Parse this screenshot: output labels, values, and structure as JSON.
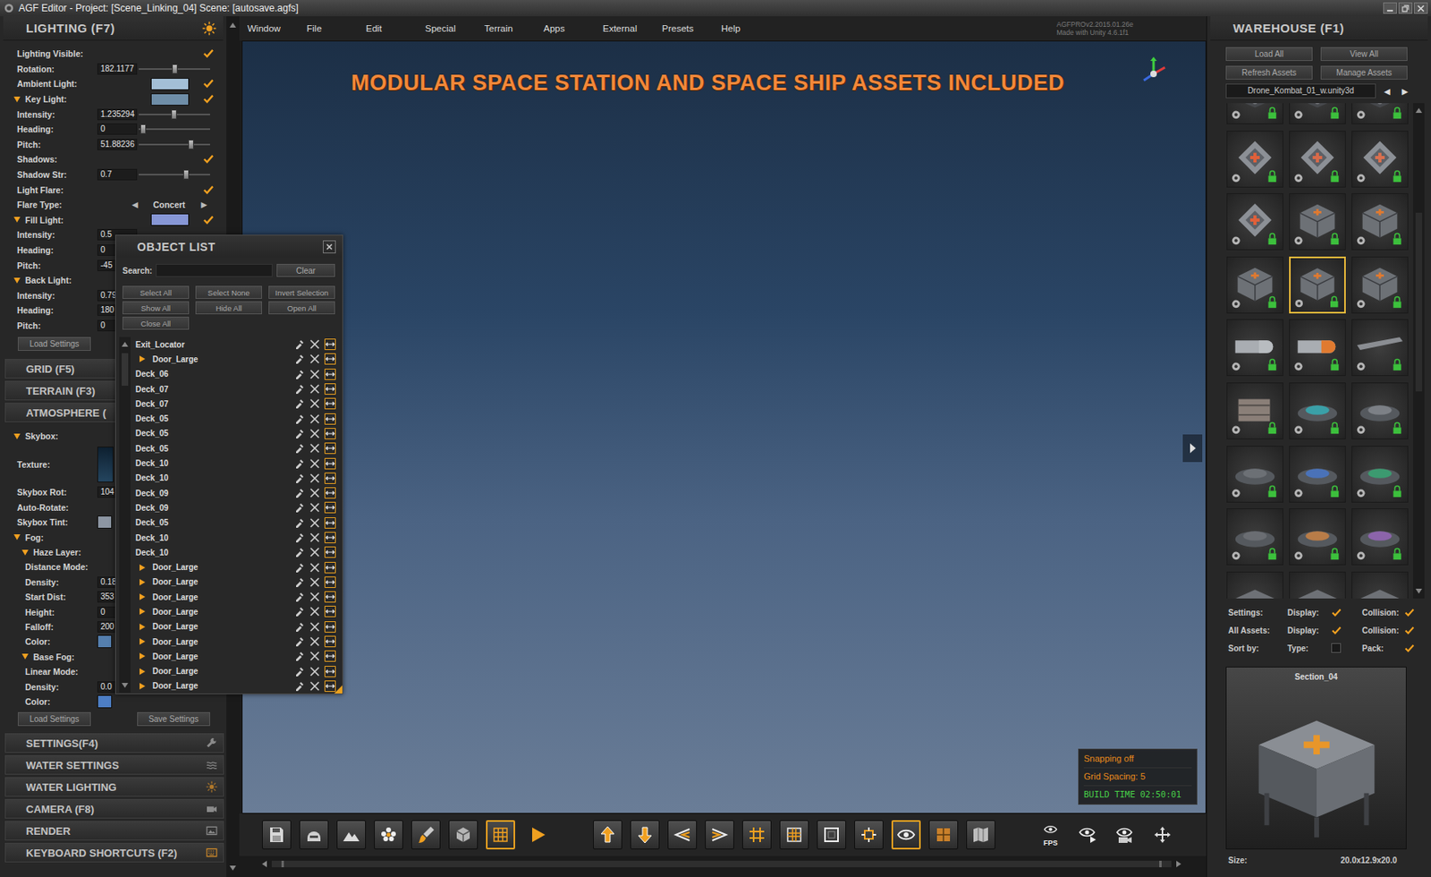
{
  "window": {
    "title": "AGF Editor - Project: [Scene_Linking_04] Scene: [autosave.agfs]"
  },
  "menu": [
    "Window",
    "File",
    "Edit",
    "Special",
    "Terrain",
    "Apps",
    "External",
    "Presets",
    "Help"
  ],
  "version": [
    "AGFPROv2.2015.01.26e",
    "Made with Unity 4.6.1f1"
  ],
  "lighting": {
    "title": "LIGHTING (F7)",
    "button": "Load Settings",
    "rows": [
      {
        "kind": "check",
        "label": "Lighting Visible:",
        "checked": true
      },
      {
        "kind": "slider",
        "label": "Rotation:",
        "value": "182.1177",
        "level": 0.5
      },
      {
        "kind": "color",
        "label": "Ambient Light:",
        "color": "#a3bfd6",
        "checked": true
      },
      {
        "kind": "color",
        "label": "Key Light:",
        "expanded": true,
        "color": "#6f8ea8",
        "checked": true
      },
      {
        "kind": "slider",
        "label": "Intensity:",
        "value": "1.235294",
        "level": 0.49
      },
      {
        "kind": "slider",
        "label": "Heading:",
        "value": "0",
        "level": 0.03
      },
      {
        "kind": "slider",
        "label": "Pitch:",
        "value": "51.88236",
        "level": 0.75
      },
      {
        "kind": "check",
        "label": "Shadows:",
        "checked": true
      },
      {
        "kind": "slider",
        "label": "Shadow Str:",
        "value": "0.7",
        "level": 0.68
      },
      {
        "kind": "check",
        "label": "Light Flare:",
        "checked": true
      },
      {
        "kind": "select",
        "label": "Flare Type:",
        "value": "Concert",
        "prev": "◀",
        "next": "▶"
      },
      {
        "kind": "color",
        "label": "Fill Light:",
        "expanded": true,
        "color": "#8797d6",
        "checked": true
      },
      {
        "kind": "value",
        "label": "Intensity:",
        "value": "0.5"
      },
      {
        "kind": "value",
        "label": "Heading:",
        "value": "0"
      },
      {
        "kind": "value",
        "label": "Pitch:",
        "value": "-45"
      },
      {
        "kind": "header",
        "label": "Back Light:",
        "expanded": true
      },
      {
        "kind": "value",
        "label": "Intensity:",
        "value": "0.79"
      },
      {
        "kind": "value",
        "label": "Heading:",
        "value": "180"
      },
      {
        "kind": "value",
        "label": "Pitch:",
        "value": "0"
      }
    ]
  },
  "sections_top": [
    "GRID (F5)",
    "TERRAIN (F3)",
    "ATMOSPHERE ("
  ],
  "atmosphere": {
    "buttons": [
      "Load Settings",
      "Save Settings"
    ],
    "rows": [
      {
        "kind": "header",
        "label": "Skybox:",
        "expanded": true,
        "nested": false
      },
      {
        "kind": "texture",
        "label": "Texture:",
        "nested": false
      },
      {
        "kind": "value",
        "label": "Skybox Rot:",
        "value": "104",
        "nested": false
      },
      {
        "kind": "plain",
        "label": "Auto-Rotate:",
        "nested": false
      },
      {
        "kind": "swatch",
        "label": "Skybox Tint:",
        "color": "#8d96a3",
        "nested": false
      },
      {
        "kind": "header",
        "label": "Fog:",
        "expanded": true,
        "nested": false
      },
      {
        "kind": "header",
        "label": "Haze Layer:",
        "expanded": true,
        "nested": true
      },
      {
        "kind": "plain",
        "label": "Distance Mode:",
        "nested": true
      },
      {
        "kind": "value",
        "label": "Density:",
        "value": "0.18",
        "nested": true
      },
      {
        "kind": "value",
        "label": "Start Dist:",
        "value": "353",
        "nested": true
      },
      {
        "kind": "value",
        "label": "Height:",
        "value": "0",
        "nested": true
      },
      {
        "kind": "value",
        "label": "Falloff:",
        "value": "200",
        "nested": true
      },
      {
        "kind": "swatch",
        "label": "Color:",
        "color": "#557fae",
        "nested": true
      },
      {
        "kind": "header",
        "label": "Base Fog:",
        "expanded": true,
        "nested": true
      },
      {
        "kind": "plain",
        "label": "Linear Mode:",
        "nested": true
      },
      {
        "kind": "value",
        "label": "Density:",
        "value": "0.0",
        "nested": true
      },
      {
        "kind": "swatch",
        "label": "Color:",
        "color": "#4d7ec4",
        "nested": true
      }
    ]
  },
  "sections_bottom": [
    {
      "label": "SETTINGS(F4)",
      "kind": "wrench"
    },
    {
      "label": "WATER SETTINGS",
      "kind": "waves"
    },
    {
      "label": "WATER LIGHTING",
      "kind": "sun-dim"
    },
    {
      "label": "CAMERA (F8)",
      "kind": "camera"
    },
    {
      "label": "RENDER",
      "kind": "image"
    },
    {
      "label": "KEYBOARD SHORTCUTS (F2)",
      "kind": "keyboard"
    }
  ],
  "object_list": {
    "title": "OBJECT LIST",
    "search_label": "Search:",
    "search_value": "",
    "clear": "Clear",
    "buttons": [
      "Select All",
      "Select None",
      "Invert Selection",
      "Show All",
      "Hide All",
      "Open All",
      "Close All"
    ],
    "items": [
      {
        "name": "Exit_Locator",
        "group": false
      },
      {
        "name": "Door_Large",
        "group": true,
        "expanded": false
      },
      {
        "name": "Deck_06",
        "group": false
      },
      {
        "name": "Deck_07",
        "group": false
      },
      {
        "name": "Deck_07",
        "group": false
      },
      {
        "name": "Deck_05",
        "group": false
      },
      {
        "name": "Deck_05",
        "group": false
      },
      {
        "name": "Deck_05",
        "group": false
      },
      {
        "name": "Deck_10",
        "group": false
      },
      {
        "name": "Deck_10",
        "group": false
      },
      {
        "name": "Deck_09",
        "group": false
      },
      {
        "name": "Deck_09",
        "group": false
      },
      {
        "name": "Deck_05",
        "group": false
      },
      {
        "name": "Deck_10",
        "group": false
      },
      {
        "name": "Deck_10",
        "group": false
      },
      {
        "name": "Door_Large",
        "group": true,
        "expanded": false
      },
      {
        "name": "Door_Large",
        "group": true,
        "expanded": false
      },
      {
        "name": "Door_Large",
        "group": true,
        "expanded": false
      },
      {
        "name": "Door_Large",
        "group": true,
        "expanded": false
      },
      {
        "name": "Door_Large",
        "group": true,
        "expanded": false
      },
      {
        "name": "Door_Large",
        "group": true,
        "expanded": false
      },
      {
        "name": "Door_Large",
        "group": true,
        "expanded": false
      },
      {
        "name": "Door_Large",
        "group": true,
        "expanded": false
      },
      {
        "name": "Door_Large",
        "group": true,
        "expanded": false
      }
    ]
  },
  "viewport": {
    "banner": "MODULAR SPACE STATION AND SPACE SHIP ASSETS INCLUDED",
    "status": [
      "Snapping off",
      "Grid Spacing: 5"
    ],
    "build_time": "BUILD TIME 02:50:01"
  },
  "toolbar": [
    {
      "buttons": [
        {
          "kind": "save",
          "selected": false
        },
        {
          "kind": "mesh",
          "selected": false
        },
        {
          "kind": "terrain",
          "selected": false
        },
        {
          "kind": "flower",
          "selected": false
        },
        {
          "kind": "brush",
          "selected": false
        },
        {
          "kind": "cube",
          "selected": false
        },
        {
          "kind": "grid",
          "selected": true
        },
        {
          "kind": "play",
          "selected": false
        }
      ]
    },
    {
      "buttons": [
        {
          "kind": "up",
          "selected": false
        },
        {
          "kind": "down",
          "selected": false
        },
        {
          "kind": "left",
          "selected": false
        },
        {
          "kind": "right",
          "selected": false
        },
        {
          "kind": "hash",
          "selected": false
        },
        {
          "kind": "grid-fine",
          "selected": false
        },
        {
          "kind": "frame",
          "selected": false
        },
        {
          "kind": "snap",
          "selected": false
        },
        {
          "kind": "eye",
          "selected": true
        },
        {
          "kind": "paint",
          "selected": false
        },
        {
          "kind": "map",
          "selected": false
        }
      ]
    },
    {
      "buttons": [
        {
          "kind": "eye-fps",
          "selected": false,
          "label": "FPS"
        },
        {
          "kind": "eye-play",
          "selected": false
        },
        {
          "kind": "eye-cam",
          "selected": false
        },
        {
          "kind": "move",
          "selected": false
        }
      ]
    }
  ],
  "warehouse": {
    "title": "WAREHOUSE (F1)",
    "buttons": [
      "Load All",
      "View All",
      "Refresh Assets",
      "Manage Assets"
    ],
    "pack": "Drone_Kombat_01_w.unity3d",
    "prev": "◀",
    "next": "▶",
    "assets": [
      {
        "kind": "plate",
        "color": "#7a7d82",
        "selected": false
      },
      {
        "kind": "plate",
        "color": "#7a7d82",
        "selected": false
      },
      {
        "kind": "plate",
        "color": "#7a7d82",
        "selected": false
      },
      {
        "kind": "panel",
        "color": "#e0603a",
        "selected": false
      },
      {
        "kind": "panel",
        "color": "#d86a4a",
        "selected": false
      },
      {
        "kind": "panel",
        "color": "#d97050",
        "selected": false
      },
      {
        "kind": "panel",
        "color": "#e0603a",
        "selected": false
      },
      {
        "kind": "module",
        "color": "#e07a30",
        "selected": false
      },
      {
        "kind": "module",
        "color": "#e07a30",
        "selected": false
      },
      {
        "kind": "module",
        "color": "#e07a30",
        "selected": false
      },
      {
        "kind": "module",
        "color": "#e07a30",
        "selected": true
      },
      {
        "kind": "module",
        "color": "#e07a30",
        "selected": false
      },
      {
        "kind": "pod",
        "color": "#b8bcc0",
        "selected": false
      },
      {
        "kind": "pod",
        "color": "#e07a30",
        "selected": false
      },
      {
        "kind": "wedge",
        "color": "#8a8d92",
        "selected": false
      },
      {
        "kind": "crate",
        "color": "#8a7f78",
        "selected": false
      },
      {
        "kind": "disc",
        "color": "#3aa0a8",
        "selected": false
      },
      {
        "kind": "disc",
        "color": "#7c8086",
        "selected": false
      },
      {
        "kind": "disc",
        "color": "#6c7075",
        "selected": false
      },
      {
        "kind": "disc",
        "color": "#4a72b8",
        "selected": false
      },
      {
        "kind": "disc",
        "color": "#3c9a70",
        "selected": false
      },
      {
        "kind": "disc",
        "color": "#6a6d72",
        "selected": false
      },
      {
        "kind": "disc",
        "color": "#b87c48",
        "selected": false
      },
      {
        "kind": "disc",
        "color": "#8c64aa",
        "selected": false
      },
      {
        "kind": "plate",
        "color": "#6e7176",
        "selected": false
      },
      {
        "kind": "plate",
        "color": "#6e7176",
        "selected": false
      },
      {
        "kind": "plate",
        "color": "#6e7176",
        "selected": false
      }
    ],
    "settings": [
      {
        "label": "Settings:",
        "options": [
          {
            "label": "Display:",
            "checked": true
          },
          {
            "label": "Collision:",
            "checked": true
          }
        ]
      },
      {
        "label": "All Assets:",
        "options": [
          {
            "label": "Display:",
            "checked": true
          },
          {
            "label": "Collision:",
            "checked": true
          }
        ]
      },
      {
        "label": "Sort by:",
        "options": [
          {
            "label": "Type:",
            "checked": false
          },
          {
            "label": "Pack:",
            "checked": true
          }
        ]
      }
    ],
    "preview": {
      "title": "Section_04"
    },
    "size_label": "Size:",
    "size": "20.0x12.9x20.0"
  }
}
